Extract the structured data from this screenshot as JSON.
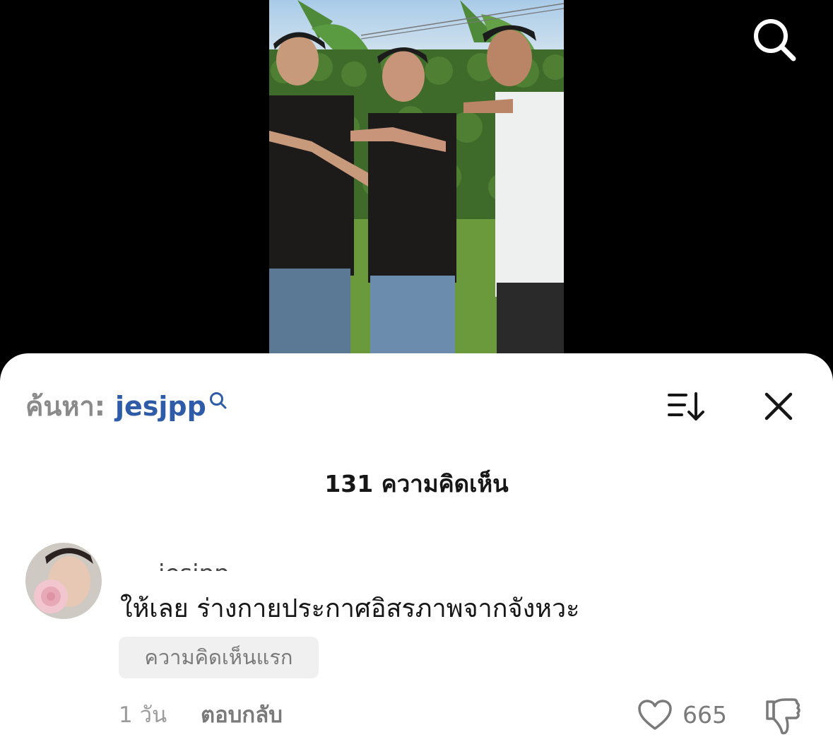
{
  "video": {
    "thumbnail_icon": "dance-video-frame"
  },
  "top_controls": {
    "search_icon": "search-icon"
  },
  "sheet": {
    "search_prefix": "ค้นหา:",
    "search_query": "jesjpp",
    "sort_icon": "sort-icon",
    "close_icon": "close-icon",
    "comment_count_title": "131 ความคิดเห็น"
  },
  "comment": {
    "username": "jesjpp",
    "avatar_icon": "avatar",
    "text": "ให้เลย ร่างกายประกาศอิสรภาพจากจังหวะ",
    "badge": "ความคิดเห็นแรก",
    "time": "1 วัน",
    "reply_label": "ตอบกลับ",
    "like_count": "665",
    "like_icon": "heart-icon",
    "dislike_icon": "thumbs-down-icon"
  },
  "colors": {
    "link_blue": "#2e5ca8",
    "muted_gray": "#7a7a7a",
    "badge_bg": "#f0f0f0"
  }
}
